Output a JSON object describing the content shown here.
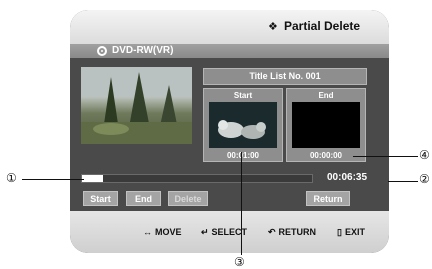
{
  "header": {
    "title": "Partial Delete"
  },
  "source": {
    "label": "DVD-RW(VR)"
  },
  "title_list": {
    "label": "Title List No. 001"
  },
  "start_frame": {
    "header": "Start",
    "time": "00:01:00"
  },
  "end_frame": {
    "header": "End",
    "time": "00:00:00"
  },
  "progress": {
    "fraction": 0.09,
    "total_time": "00:06:35"
  },
  "buttons": {
    "start": "Start",
    "end": "End",
    "delete": "Delete",
    "return": "Return"
  },
  "footer": {
    "move": "MOVE",
    "select": "SELECT",
    "return": "RETURN",
    "exit": "EXIT",
    "move_icon": "↔",
    "select_icon": "↵",
    "return_icon": "↶",
    "exit_icon": "▯"
  },
  "callouts": {
    "one": "①",
    "two": "②",
    "three": "③",
    "four": "④"
  },
  "colors": {
    "panel": "#4a4a4a",
    "button": "#a4a4a4",
    "header": "#e6e6e6"
  }
}
